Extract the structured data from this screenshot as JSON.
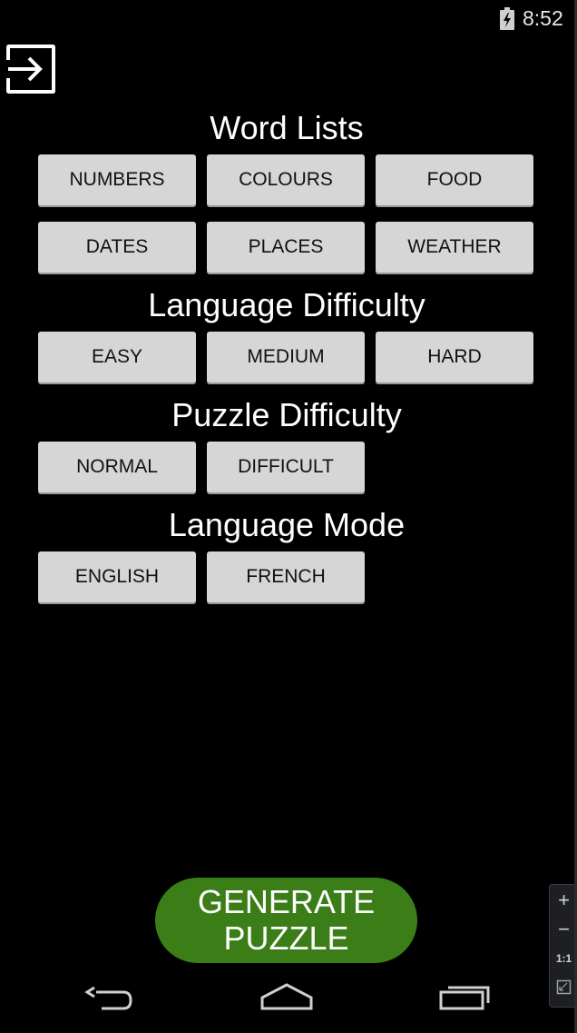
{
  "status_bar": {
    "time": "8:52",
    "battery_icon": "battery-charging-icon"
  },
  "toolbar": {
    "exit_icon": "exit-arrow-icon"
  },
  "word_lists": {
    "title": "Word Lists",
    "options": [
      "NUMBERS",
      "COLOURS",
      "FOOD",
      "DATES",
      "PLACES",
      "WEATHER"
    ]
  },
  "language_difficulty": {
    "title": "Language Difficulty",
    "options": [
      "EASY",
      "MEDIUM",
      "HARD"
    ]
  },
  "puzzle_difficulty": {
    "title": "Puzzle Difficulty",
    "options": [
      "NORMAL",
      "DIFFICULT"
    ]
  },
  "language_mode": {
    "title": "Language Mode",
    "options": [
      "ENGLISH",
      "FRENCH"
    ]
  },
  "generate": {
    "line1": "GENERATE",
    "line2": "PUZZLE",
    "color": "#3b7d17"
  },
  "nav_bar": {
    "back_icon": "back-arrow-icon",
    "home_icon": "home-icon",
    "recents_icon": "recent-apps-icon"
  },
  "zoom_panel": {
    "zoom_in": "+",
    "zoom_out": "−",
    "actual_size": "1:1",
    "fit_icon": "fit-screen-icon"
  }
}
